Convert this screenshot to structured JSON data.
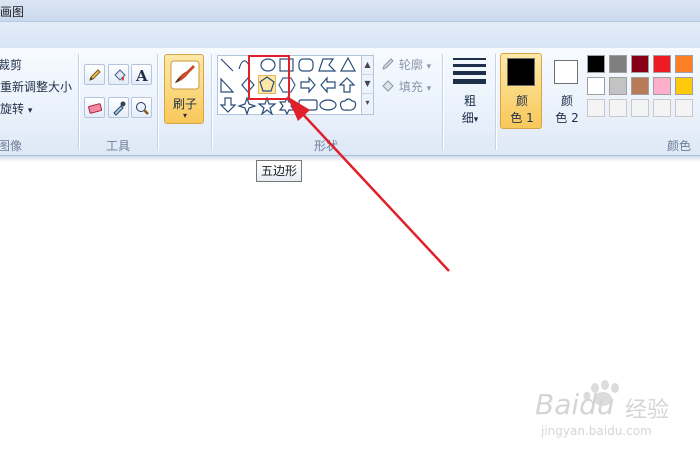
{
  "window": {
    "title": "画图"
  },
  "image_group": {
    "items": [
      "裁剪",
      "重新调整大小",
      "旋转"
    ],
    "rotate_arrow": "▾",
    "label": "图像"
  },
  "tools_group": {
    "label": "工具"
  },
  "brush": {
    "label": "刷子",
    "arrow": "▾"
  },
  "shapes_group": {
    "label": "形状",
    "outline_label": "轮廓",
    "fill_label": "填充",
    "dropdown_arrow": "▾",
    "selected_shape": "pentagon-icon"
  },
  "thickness": {
    "label_line1": "粗",
    "label_line2": "细"
  },
  "color1": {
    "label_line1": "颜",
    "label_line2": "色 1",
    "value": "#000000"
  },
  "color2": {
    "label_line1": "颜",
    "label_line2": "色 2",
    "value": "#ffffff"
  },
  "colors_group": {
    "label": "颜色",
    "palette_row1": [
      "#000000",
      "#7f7f7f",
      "#880015",
      "#ed1c24",
      "#ff7f27"
    ],
    "palette_row2": [
      "#ffffff",
      "#c3c3c3",
      "#b97a57",
      "#ffaec9",
      "#ffc90e"
    ]
  },
  "tooltip": {
    "text": "五边形"
  },
  "watermark": {
    "brand": "Baidu",
    "product": "经验",
    "url": "jingyan.baidu.com"
  },
  "accent_colors": {
    "annotation_red": "#e0202a",
    "selected_gold": "#f8c85a"
  }
}
